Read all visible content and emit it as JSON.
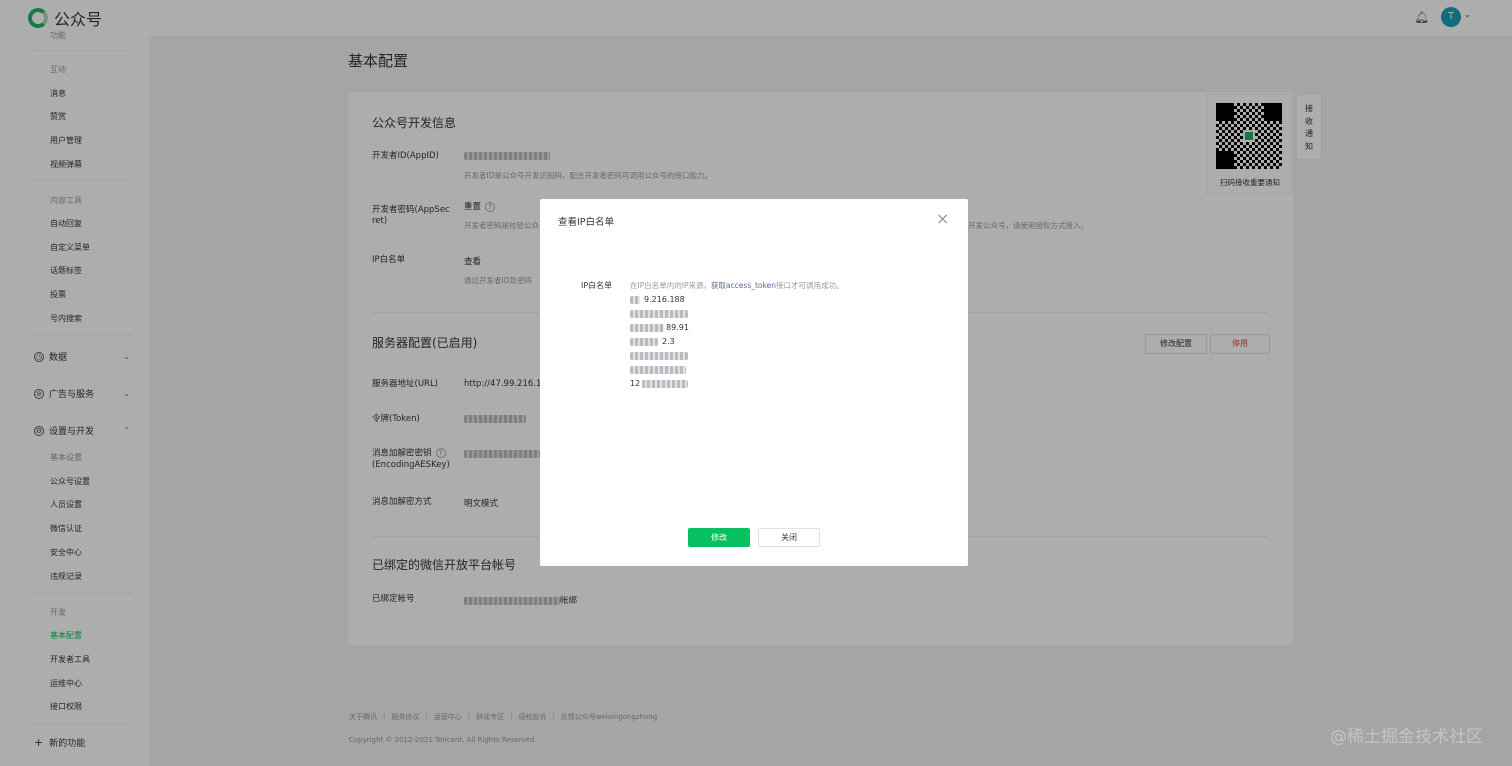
{
  "app": {
    "name": "公众号"
  },
  "header": {
    "avatar_letter": "T"
  },
  "sidebar": {
    "top_cut": "功能",
    "interact_title": "互动",
    "interact_items": [
      "消息",
      "赞赏",
      "用户管理",
      "视频弹幕"
    ],
    "content_title": "内容工具",
    "content_items": [
      "自动回复",
      "自定义菜单",
      "话题标签",
      "投票",
      "号内搜索"
    ],
    "sections": [
      "数据",
      "广告与服务",
      "设置与开发"
    ],
    "basic_title": "基本设置",
    "basic_items": [
      "公众号设置",
      "人员设置",
      "微信认证",
      "安全中心",
      "违规记录"
    ],
    "dev_title": "开发",
    "dev_items": [
      "基本配置",
      "开发者工具",
      "运维中心",
      "接口权限"
    ],
    "new_func": "新的功能"
  },
  "main": {
    "page_title": "基本配置",
    "dev_info": {
      "title": "公众号开发信息",
      "appid_label": "开发者ID(AppID)",
      "appid_desc": "开发者ID是公众号开发识别码，配合开发者密码可调用公众号的接口能力。",
      "secret_label_1": "开发者密码(AppSec",
      "secret_label_2": "ret)",
      "secret_reset": "重置",
      "secret_desc": "开发者密码是校验公众",
      "secret_desc_tail": "开发公众号，请使用授权方式接入。",
      "ip_label": "IP白名单",
      "ip_view": "查看",
      "ip_desc": "通过开发者ID及密码"
    },
    "server": {
      "title": "服务器配置(已启用)",
      "modify_button": "修改配置",
      "disable_button": "停用",
      "url_label": "服务器地址(URL)",
      "url_value": "http://47.99.216.19",
      "token_label": "令牌(Token)",
      "aes_label_1": "消息加解密密钥",
      "aes_label_2": "(EncodingAESKey)",
      "mode_label": "消息加解密方式",
      "mode_value": "明文模式"
    },
    "bound": {
      "title": "已绑定的微信开放平台帐号",
      "label": "已绑定帐号",
      "value_tail": "帐绑"
    }
  },
  "qr": {
    "label": "扫码接收重要通知",
    "notify_tab": [
      "接",
      "收",
      "通",
      "知"
    ]
  },
  "footer": {
    "links": [
      "关于腾讯",
      "服务协议",
      "运营中心",
      "辟谣专区",
      "侵权投诉",
      "反馈公众号weixingongzhong"
    ],
    "copyright": "Copyright © 2012-2021 Tencent. All Rights Reserved."
  },
  "watermark": "@稀土掘金技术社区",
  "modal": {
    "title": "查看IP白名单",
    "close_icon": "×",
    "field_label": "IP白名单",
    "desc_prefix": "在IP白名单内的IP来源，",
    "desc_link": "获取access_token",
    "desc_suffix": "接口才可调用成功。",
    "ip_fragments": [
      "9.216.188",
      "",
      "89.91",
      "2.3",
      "",
      "",
      "12"
    ],
    "primary_button": "修改",
    "default_button": "关闭"
  }
}
